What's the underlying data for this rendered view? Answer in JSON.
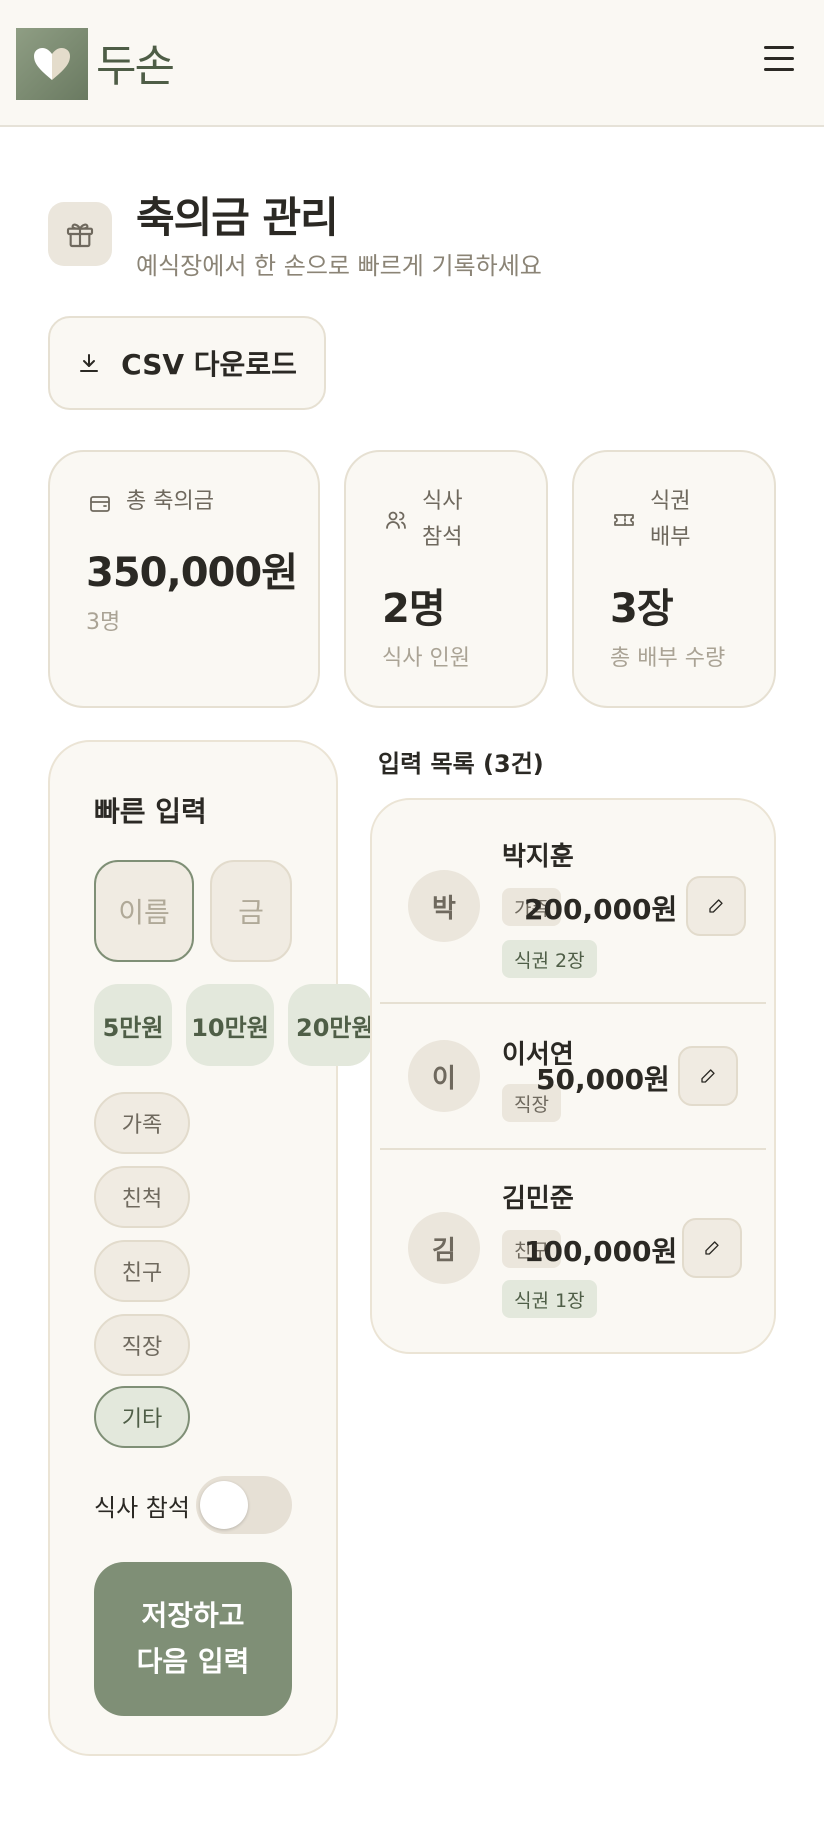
{
  "header": {
    "logo_text": "두손",
    "menu_icon": "hamburger-menu-icon"
  },
  "page": {
    "title": "축의금 관리",
    "subtitle": "예식장에서 한 손으로 빠르게 기록하세요",
    "title_icon": "gift-icon"
  },
  "csv_button": {
    "label": "CSV 다운로드",
    "icon": "download-icon"
  },
  "stats": {
    "total": {
      "label": "총 축의금",
      "value": "350,000원",
      "sub": "3명",
      "icon": "wallet-icon"
    },
    "meal": {
      "label_1": "식사",
      "label_2": "참석",
      "value": "2명",
      "sub": "식사 인원",
      "icon": "users-icon"
    },
    "ticket": {
      "label_1": "식권",
      "label_2": "배부",
      "value": "3장",
      "sub": "총 배부 수량",
      "icon": "ticket-icon"
    }
  },
  "quick_input": {
    "title": "빠른 입력",
    "name_placeholder": "이름",
    "amount_placeholder": "금",
    "amount_buttons": [
      "5만원",
      "10만원",
      "20만원"
    ],
    "relations": [
      "가족",
      "친척",
      "친구",
      "직장",
      "기타"
    ],
    "selected_relation": "기타",
    "meal_label": "식사 참석",
    "meal_toggle_on": false,
    "save_label": "저장하고\n다음 입력"
  },
  "list": {
    "title": "입력 목록 (3건)",
    "entries": [
      {
        "initial": "박",
        "name": "박지훈",
        "relation": "가족",
        "amount": "200,000원",
        "ticket": "식권 2장"
      },
      {
        "initial": "이",
        "name": "이서연",
        "relation": "직장",
        "amount": "50,000원",
        "ticket": ""
      },
      {
        "initial": "김",
        "name": "김민준",
        "relation": "친구",
        "amount": "100,000원",
        "ticket": "식권 1장"
      }
    ]
  },
  "colors": {
    "accent": "#7f8f76",
    "accent_light": "#e3e8dc",
    "background": "#faf8f3",
    "border": "#e6e0d2",
    "text": "#2b2924",
    "muted": "#8b8476"
  }
}
